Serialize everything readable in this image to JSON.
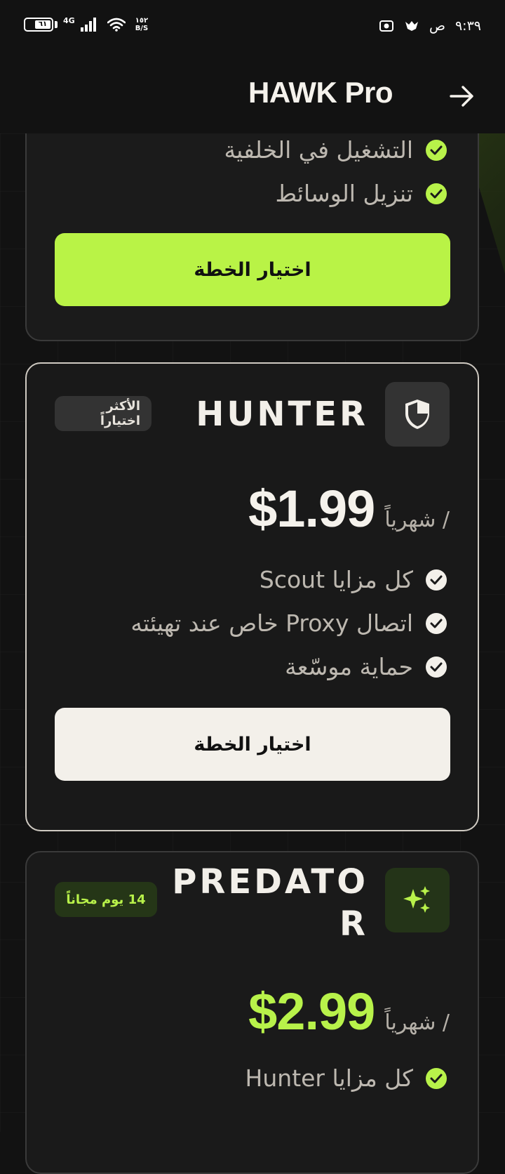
{
  "status_bar": {
    "battery": "٦١",
    "network": "4G",
    "speed_value": "١٥٢",
    "speed_unit": "B/S",
    "time": "٩:٣٩",
    "period": "ص"
  },
  "header": {
    "title": "HAWK Pro"
  },
  "plans": {
    "top": {
      "features": [
        "التشغيل في الخلفية",
        "تنزيل الوسائط"
      ],
      "button_label": "اختيار الخطة"
    },
    "hunter": {
      "name": "HUNTER",
      "badge": "الأكثر اختياراً",
      "price": "$1.99",
      "period": "/ شهرياً",
      "features": [
        "كل مزايا Scout",
        "اتصال Proxy خاص عند تهيئته",
        "حماية موسّعة"
      ],
      "button_label": "اختيار الخطة"
    },
    "predator": {
      "name_line1": "PREDATO",
      "name_line2": "R",
      "badge": "14 يوم مجاناً",
      "price": "$2.99",
      "period": "/ شهرياً",
      "features": [
        "كل مزايا Hunter"
      ]
    }
  },
  "colors": {
    "accent": "#b8f24a",
    "background": "#121212",
    "card": "#191919"
  }
}
